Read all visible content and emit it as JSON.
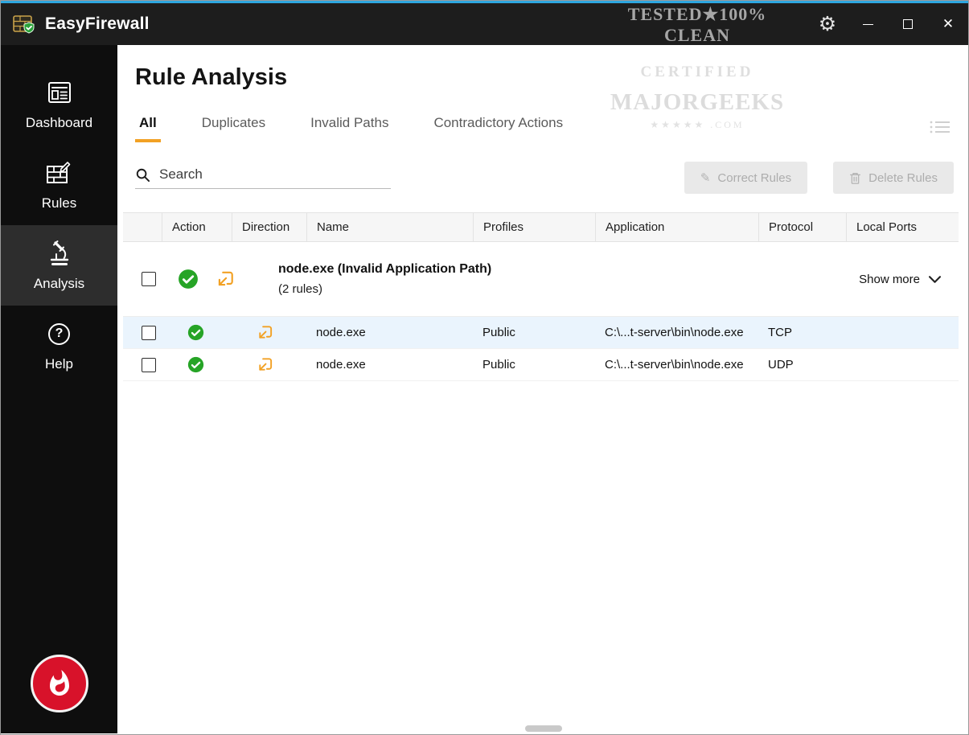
{
  "titlebar": {
    "app_name_regular": "Easy",
    "app_name_bold": "Firewall"
  },
  "icons": {
    "gear": "⚙",
    "close": "✕",
    "pencil": "✎",
    "help": "?"
  },
  "sidebar": {
    "items": [
      {
        "label": "Dashboard"
      },
      {
        "label": "Rules"
      },
      {
        "label": "Analysis",
        "active": true
      },
      {
        "label": "Help"
      }
    ]
  },
  "main": {
    "page_title": "Rule Analysis",
    "tabs": [
      {
        "label": "All",
        "active": true
      },
      {
        "label": "Duplicates"
      },
      {
        "label": "Invalid Paths"
      },
      {
        "label": "Contradictory Actions"
      }
    ],
    "search": {
      "placeholder": "Search"
    },
    "actions": {
      "correct": "Correct Rules",
      "delete": "Delete Rules"
    },
    "table": {
      "columns": [
        "",
        "Action",
        "Direction",
        "Name",
        "Profiles",
        "Application",
        "Protocol",
        "Local Ports"
      ],
      "group": {
        "title": "node.exe (Invalid Application Path)",
        "count": "(2 rules)",
        "show_more": "Show more"
      },
      "rows": [
        {
          "name": "node.exe",
          "profiles": "Public",
          "application": "C:\\...t-server\\bin\\node.exe",
          "protocol": "TCP",
          "local_ports": ""
        },
        {
          "name": "node.exe",
          "profiles": "Public",
          "application": "C:\\...t-server\\bin\\node.exe",
          "protocol": "UDP",
          "local_ports": ""
        }
      ]
    }
  },
  "watermark": {
    "line1": "TESTED★100% CLEAN",
    "line2": "CERTIFIED",
    "line3": "MAJORGEEKS",
    "line4": "★★★★★ .COM"
  }
}
